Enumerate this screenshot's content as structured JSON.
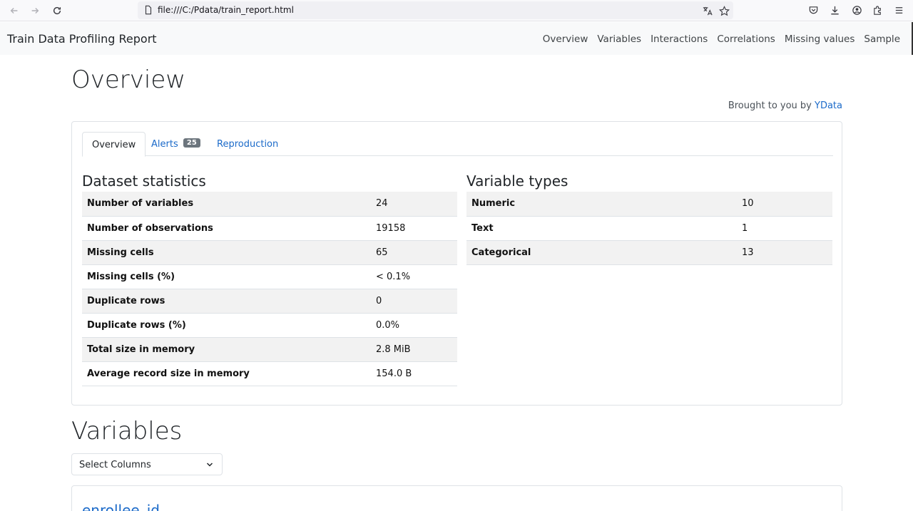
{
  "browser": {
    "url": "file:///C:/Pdata/train_report.html"
  },
  "navbar": {
    "brand": "Train Data Profiling Report",
    "links": [
      "Overview",
      "Variables",
      "Interactions",
      "Correlations",
      "Missing values",
      "Sample"
    ]
  },
  "overview": {
    "heading": "Overview",
    "brought_prefix": "Brought to you by",
    "brought_link": "YData",
    "tabs": {
      "overview": "Overview",
      "alerts": "Alerts",
      "alerts_count": "25",
      "reproduction": "Reproduction"
    },
    "dataset_statistics": {
      "title": "Dataset statistics",
      "rows": [
        {
          "label": "Number of variables",
          "value": "24"
        },
        {
          "label": "Number of observations",
          "value": "19158"
        },
        {
          "label": "Missing cells",
          "value": "65"
        },
        {
          "label": "Missing cells (%)",
          "value": "< 0.1%"
        },
        {
          "label": "Duplicate rows",
          "value": "0"
        },
        {
          "label": "Duplicate rows (%)",
          "value": "0.0%"
        },
        {
          "label": "Total size in memory",
          "value": "2.8 MiB"
        },
        {
          "label": "Average record size in memory",
          "value": "154.0 B"
        }
      ]
    },
    "variable_types": {
      "title": "Variable types",
      "rows": [
        {
          "label": "Numeric",
          "value": "10"
        },
        {
          "label": "Text",
          "value": "1"
        },
        {
          "label": "Categorical",
          "value": "13"
        }
      ]
    }
  },
  "variables": {
    "heading": "Variables",
    "select_label": "Select Columns",
    "first_variable": "enrollee_id"
  },
  "colors": {
    "link": "#1b6ac9",
    "badge": "#6c757d",
    "stripe": "#f2f2f2"
  }
}
